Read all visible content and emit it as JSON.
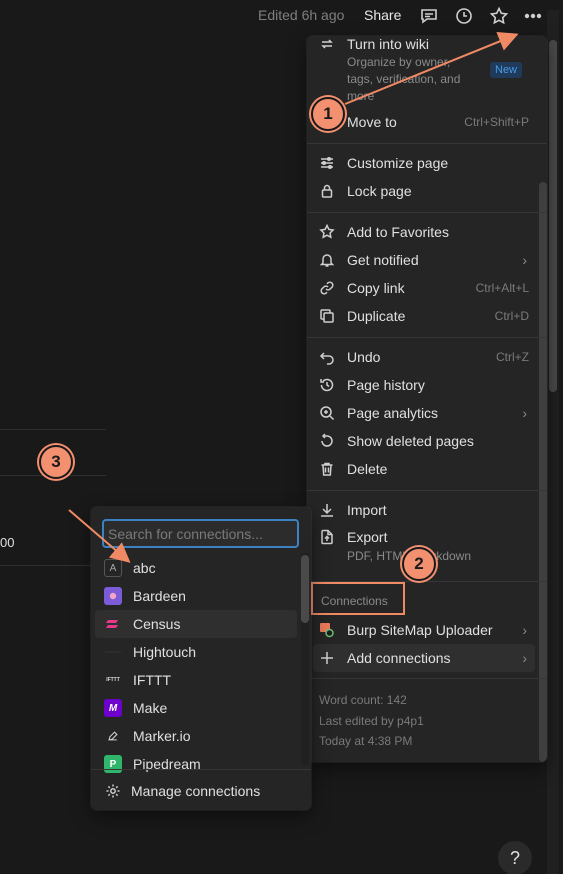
{
  "topbar": {
    "edited": "Edited 6h ago",
    "share": "Share",
    "icons": [
      "comment-icon",
      "history-icon",
      "star-icon",
      "more-icon"
    ]
  },
  "background": {
    "cell_fragment": "00"
  },
  "menu": {
    "turn_into_wiki": {
      "label": "Turn into wiki",
      "description_lines": [
        "Organize by owner,",
        "tags, verification, and",
        "more"
      ],
      "badge": "New"
    },
    "move_to": {
      "label": "Move to",
      "shortcut": "Ctrl+Shift+P"
    },
    "customize_page": {
      "label": "Customize page"
    },
    "lock_page": {
      "label": "Lock page"
    },
    "add_to_favorites": {
      "label": "Add to Favorites"
    },
    "get_notified": {
      "label": "Get notified"
    },
    "copy_link": {
      "label": "Copy link",
      "shortcut": "Ctrl+Alt+L"
    },
    "duplicate": {
      "label": "Duplicate",
      "shortcut": "Ctrl+D"
    },
    "undo": {
      "label": "Undo",
      "shortcut": "Ctrl+Z"
    },
    "page_history": {
      "label": "Page history"
    },
    "page_analytics": {
      "label": "Page analytics"
    },
    "show_deleted_pages": {
      "label": "Show deleted pages"
    },
    "delete": {
      "label": "Delete"
    },
    "import": {
      "label": "Import"
    },
    "export": {
      "label": "Export",
      "description": "PDF, HTML, Markdown"
    },
    "connections_heading": "Connections",
    "burp": {
      "label": "Burp SiteMap Uploader"
    },
    "add_connections": {
      "label": "Add connections"
    },
    "footer": {
      "word_count": "Word count: 142",
      "last_edited_by": "Last edited by p4p1",
      "last_edited_time": "Today at 4:38 PM"
    }
  },
  "submenu": {
    "search_placeholder": "Search for connections...",
    "items": [
      {
        "label": "abc",
        "logo_text": "A"
      },
      {
        "label": "Bardeen",
        "logo_text": ""
      },
      {
        "label": "Census",
        "logo_text": ""
      },
      {
        "label": "Hightouch",
        "logo_text": ""
      },
      {
        "label": "IFTTT",
        "logo_text": "IFTTT"
      },
      {
        "label": "Make",
        "logo_text": "M"
      },
      {
        "label": "Marker.io",
        "logo_text": ""
      },
      {
        "label": "Pipedream",
        "logo_text": "P"
      }
    ],
    "manage": "Manage connections"
  },
  "annotations": {
    "badges": [
      "1",
      "2",
      "3"
    ],
    "accent_color": "#f39070"
  },
  "help": "?"
}
